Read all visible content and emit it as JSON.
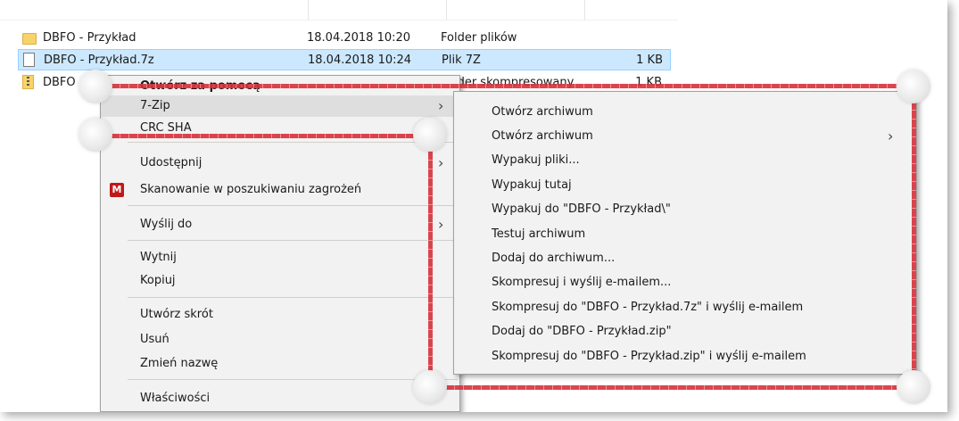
{
  "files": [
    {
      "name": "DBFO - Przykład",
      "date": "18.04.2018 10:20",
      "type": "Folder plików",
      "size": "",
      "icon": "folder-icon"
    },
    {
      "name": "DBFO - Przykład.7z",
      "date": "18.04.2018 10:24",
      "type": "Plik 7Z",
      "size": "1 KB",
      "icon": "file-icon"
    },
    {
      "name": "DBFO - Przykład.zip",
      "date": "",
      "type": "Folder skompresowany",
      "size": "1 KB",
      "icon": "zip-folder-icon"
    }
  ],
  "context_menu": {
    "items": [
      {
        "label": "Otwórz za pomocą"
      },
      {
        "label": "7-Zip"
      },
      {
        "label": "CRC SHA"
      },
      {
        "label": "Udostępnij"
      },
      {
        "label": "Skanowanie w poszukiwaniu zagrożeń",
        "icon": "mcafee-shield-icon"
      },
      {
        "label": "Wyślij do"
      },
      {
        "label": "Wytnij"
      },
      {
        "label": "Kopiuj"
      },
      {
        "label": "Utwórz skrót"
      },
      {
        "label": "Usuń"
      },
      {
        "label": "Zmień nazwę"
      },
      {
        "label": "Właściwości"
      }
    ]
  },
  "zip_submenu": {
    "items": [
      {
        "label": "Otwórz archiwum"
      },
      {
        "label": "Otwórz archiwum"
      },
      {
        "label": "Wypakuj pliki..."
      },
      {
        "label": "Wypakuj tutaj"
      },
      {
        "label": "Wypakuj do \"DBFO - Przykład\\\""
      },
      {
        "label": "Testuj archiwum"
      },
      {
        "label": "Dodaj do archiwum..."
      },
      {
        "label": "Skompresuj i wyślij e-mailem..."
      },
      {
        "label": "Skompresuj do \"DBFO - Przykład.7z\" i wyślij e-mailem"
      },
      {
        "label": "Dodaj do \"DBFO - Przykład.zip\""
      },
      {
        "label": "Skompresuj do \"DBFO - Przykład.zip\" i wyślij e-mailem"
      }
    ]
  },
  "colors": {
    "selection": "#cce8ff",
    "menu_bg": "#f2f2f2",
    "annotation": "#d8303a"
  }
}
